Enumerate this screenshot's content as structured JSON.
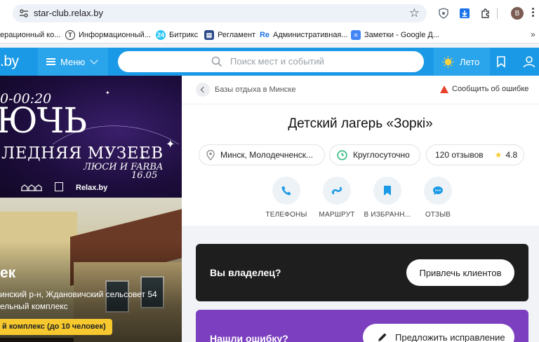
{
  "browser": {
    "url": "star-club.relax.by",
    "profile_initial": "B",
    "bookmarks": [
      {
        "label": "ерационный ко..."
      },
      {
        "label": "Информационный..."
      },
      {
        "label": "Битрикс"
      },
      {
        "label": "Регламент"
      },
      {
        "label": "Административная..."
      },
      {
        "label": "Заметки - Google Д..."
      }
    ],
    "more": "»"
  },
  "header": {
    "logo": ".by",
    "menu_label": "Меню",
    "search_placeholder": "Поиск мест и событий",
    "season_label": "Лето"
  },
  "poster": {
    "time": "0-00:20",
    "big": "ЮЧЬ",
    "subtitle": "ЛЕДНЯЯ МУЗЕЕВ",
    "names": "ЛЮСИ И FARBA",
    "date": "16.05",
    "brand": "Relax.by"
  },
  "promo": {
    "title": "ек",
    "address_line1": "инский р-н, Ждановичский сельсовет 54",
    "address_line2": "ельный комплекс",
    "tag": "й комплекс (до 10 человек)"
  },
  "card": {
    "breadcrumb": "Базы отдыха в Минске",
    "report_label": "Сообщить об ошибке",
    "title": "Детский лагерь «Зоркі»",
    "location": "Минск, Молодечненск...",
    "hours": "Круглосуточно",
    "reviews": "120 отзывов",
    "rating": "4.8",
    "actions": [
      {
        "label": "ТЕЛЕФОНЫ",
        "icon": "phone-icon"
      },
      {
        "label": "МАРШРУТ",
        "icon": "route-icon"
      },
      {
        "label": "В ИЗБРАНН...",
        "icon": "bookmark-icon"
      },
      {
        "label": "ОТЗЫВ",
        "icon": "comment-icon"
      }
    ]
  },
  "owner_banner": {
    "question": "Вы владелец?",
    "button": "Привлечь клиентов"
  },
  "error_banner": {
    "question": "Нашли ошибку?",
    "button": "Предложить исправление"
  },
  "colors": {
    "brand_blue": "#1a9ae6",
    "accent_yellow": "#f7c92f",
    "purple": "#7b3fbf",
    "warning_red": "#e8412c"
  }
}
